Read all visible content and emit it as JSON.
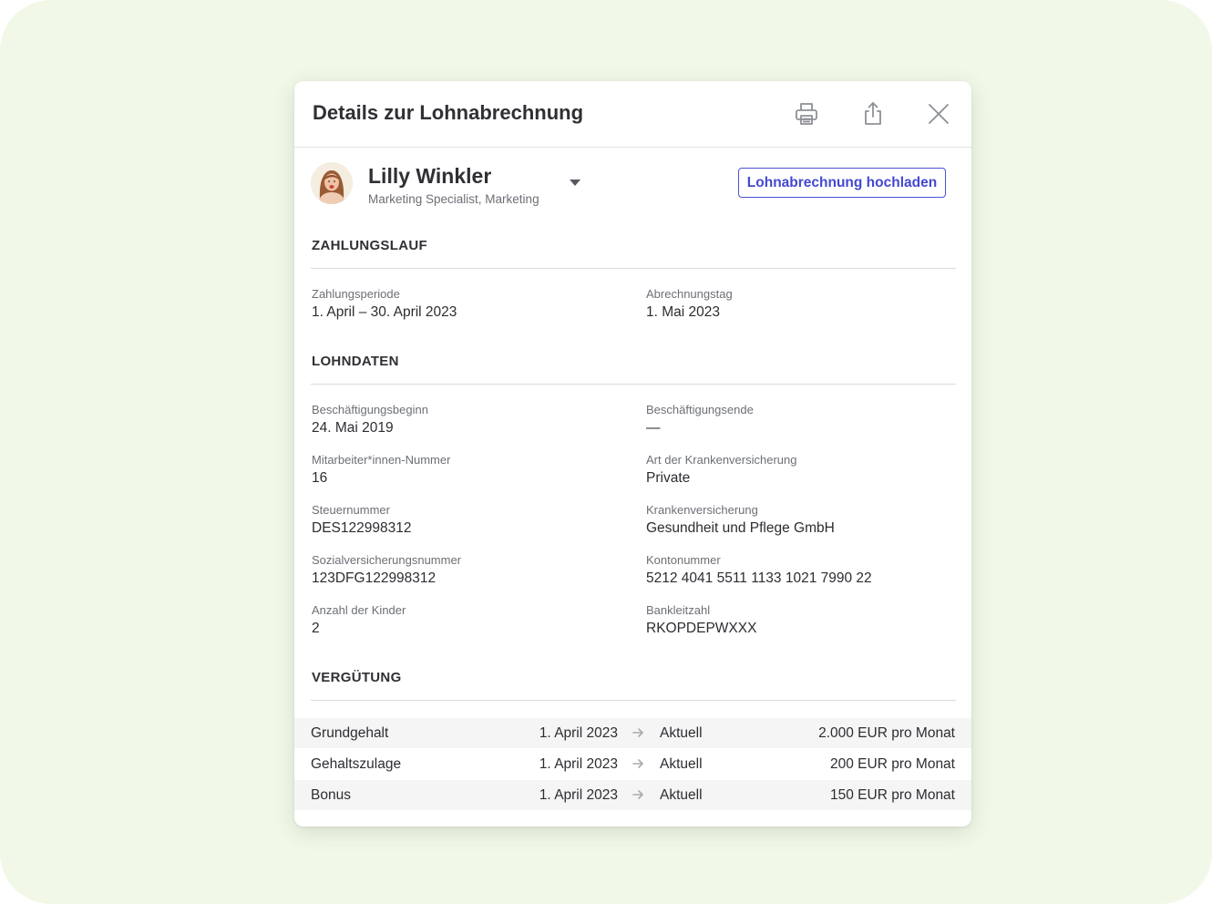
{
  "dialog": {
    "title": "Details zur Lohnabrechnung",
    "icons": [
      "printer-icon",
      "share-icon",
      "close-icon"
    ]
  },
  "employee": {
    "name": "Lilly Winkler",
    "role": "Marketing Specialist, Marketing",
    "upload_label": "Lohnabrechnung hochladen"
  },
  "zahlungslauf": {
    "heading": "ZAHLUNGSLAUF",
    "fields": [
      {
        "label": "Zahlungsperiode",
        "value": "1. April – 30. April 2023"
      },
      {
        "label": "Abrechnungstag",
        "value": "1. Mai 2023"
      }
    ]
  },
  "lohndaten": {
    "heading": "LOHNDATEN",
    "fields": [
      {
        "label": "Beschäftigungsbeginn",
        "value": "24. Mai 2019"
      },
      {
        "label": "Beschäftigungsende",
        "value": "—"
      },
      {
        "label": "Mitarbeiter*innen-Nummer",
        "value": "16"
      },
      {
        "label": "Art der Krankenversicherung",
        "value": "Private"
      },
      {
        "label": "Steuernummer",
        "value": "DES122998312"
      },
      {
        "label": "Krankenversicherung",
        "value": "Gesundheit und Pflege GmbH"
      },
      {
        "label": "Sozialversicherungsnummer",
        "value": "123DFG122998312"
      },
      {
        "label": "Kontonummer",
        "value": "5212 4041 5511 1133 1021 7990 22"
      },
      {
        "label": "Anzahl der Kinder",
        "value": "2"
      },
      {
        "label": "Bankleitzahl",
        "value": "RKOPDEPWXXX"
      }
    ]
  },
  "verguetung": {
    "heading": "VERGÜTUNG",
    "rows": [
      {
        "name": "Grundgehalt",
        "from": "1. April 2023",
        "status": "Aktuell",
        "amount": "2.000 EUR pro Monat"
      },
      {
        "name": "Gehaltszulage",
        "from": "1. April 2023",
        "status": "Aktuell",
        "amount": "200 EUR pro Monat"
      },
      {
        "name": "Bonus",
        "from": "1. April 2023",
        "status": "Aktuell",
        "amount": "150 EUR pro Monat"
      }
    ]
  },
  "colors": {
    "background": "#f1f8e8",
    "accent": "#4b50d8",
    "text": "#2b2d31",
    "muted": "#6c6f75"
  }
}
